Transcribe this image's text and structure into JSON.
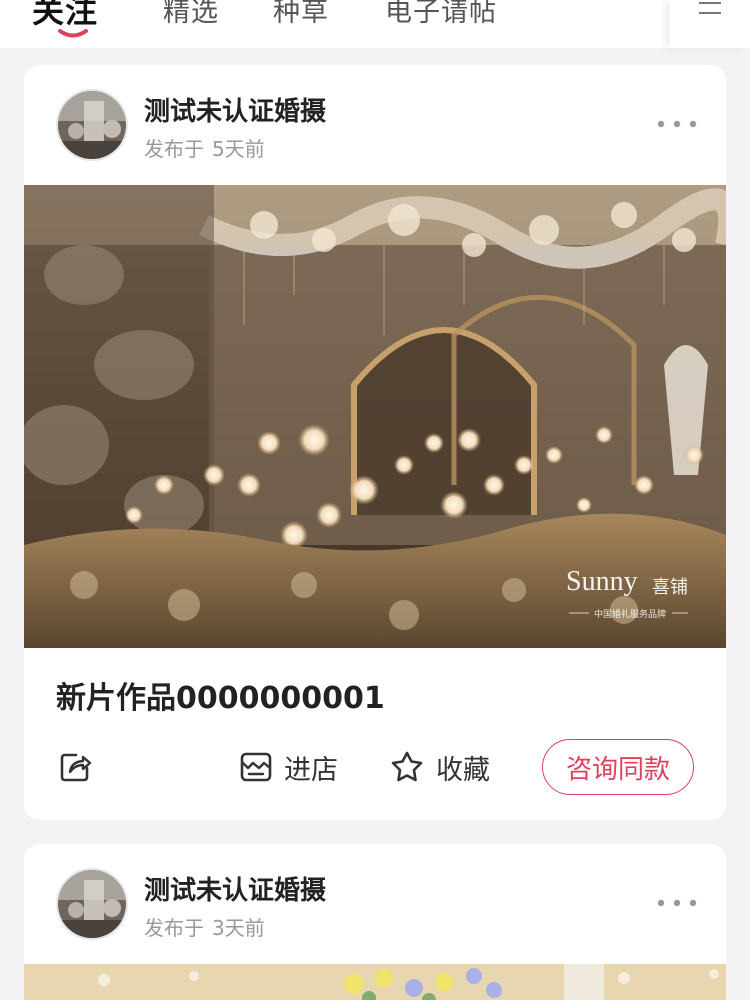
{
  "tabs": [
    {
      "label": "关注",
      "active": true
    },
    {
      "label": "精选",
      "active": false
    },
    {
      "label": "种草",
      "active": false
    },
    {
      "label": "电子请帖",
      "active": false
    }
  ],
  "accent_color": "#e0405c",
  "posts": [
    {
      "author": "测试未认证婚摄",
      "published_prefix": "发布于",
      "published_time": "5天前",
      "photo_watermark": {
        "brand": "Sunny",
        "brand_cn": "喜铺",
        "tagline": "中国婚礼服务品牌"
      },
      "caption": "新片作品0000000001",
      "actions": {
        "share_icon": "share-icon",
        "store_label": "进店",
        "favorite_label": "收藏",
        "consult_label": "咨询同款"
      }
    },
    {
      "author": "测试未认证婚摄",
      "published_prefix": "发布于",
      "published_time": "3天前"
    }
  ]
}
